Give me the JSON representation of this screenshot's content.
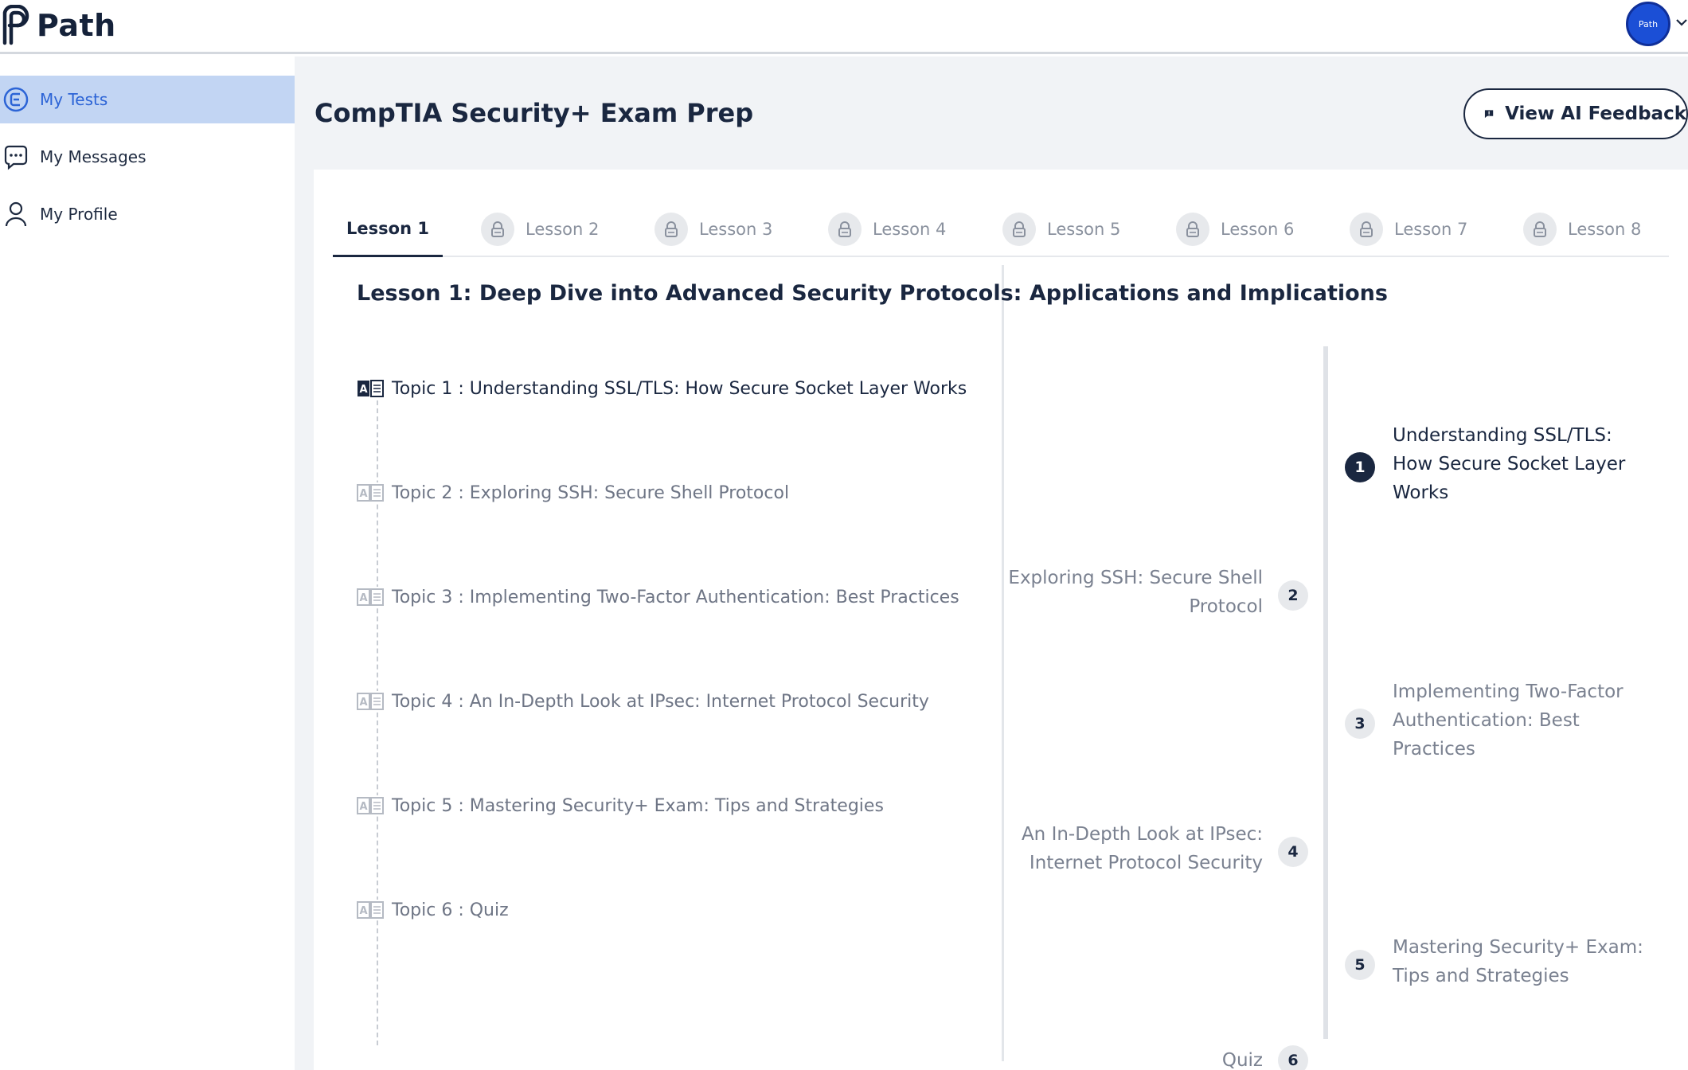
{
  "header": {
    "brand": "Path",
    "avatar_text": "Path"
  },
  "sidebar": {
    "items": [
      {
        "label": "My Tests",
        "icon": "tests-icon",
        "active": true
      },
      {
        "label": "My Messages",
        "icon": "chat-bubble-icon",
        "active": false
      },
      {
        "label": "My Profile",
        "icon": "user-icon",
        "active": false
      }
    ]
  },
  "page": {
    "title": "CompTIA Security+ Exam Prep",
    "feedback_button": "View AI Feedback"
  },
  "tabs": [
    {
      "label": "Lesson 1",
      "locked": false,
      "active": true
    },
    {
      "label": "Lesson 2",
      "locked": true,
      "active": false
    },
    {
      "label": "Lesson 3",
      "locked": true,
      "active": false
    },
    {
      "label": "Lesson 4",
      "locked": true,
      "active": false
    },
    {
      "label": "Lesson 5",
      "locked": true,
      "active": false
    },
    {
      "label": "Lesson 6",
      "locked": true,
      "active": false
    },
    {
      "label": "Lesson 7",
      "locked": true,
      "active": false
    },
    {
      "label": "Lesson 8",
      "locked": true,
      "active": false
    }
  ],
  "lesson": {
    "heading": "Lesson 1: Deep Dive into Advanced Security Protocols: Applications and Implications",
    "topics": [
      {
        "label": "Topic 1 : Understanding SSL/TLS: How Secure Socket Layer Works",
        "current": true
      },
      {
        "label": "Topic 2 : Exploring SSH: Secure Shell Protocol",
        "current": false
      },
      {
        "label": "Topic 3 : Implementing Two-Factor Authentication: Best Practices",
        "current": false
      },
      {
        "label": "Topic 4 : An In-Depth Look at IPsec: Internet Protocol Security",
        "current": false
      },
      {
        "label": "Topic 5 : Mastering Security+ Exam: Tips and Strategies",
        "current": false
      },
      {
        "label": "Topic 6 : Quiz",
        "current": false
      }
    ]
  },
  "timeline": [
    {
      "number": "1",
      "side": "right",
      "lines": [
        "Understanding SSL/TLS:",
        "How Secure Socket Layer",
        "Works"
      ],
      "current": true
    },
    {
      "number": "2",
      "side": "left",
      "lines": [
        "Exploring SSH: Secure Shell",
        "Protocol"
      ],
      "current": false
    },
    {
      "number": "3",
      "side": "right",
      "lines": [
        "Implementing Two-Factor",
        "Authentication: Best",
        "Practices"
      ],
      "current": false
    },
    {
      "number": "4",
      "side": "left",
      "lines": [
        "An In-Depth Look at IPsec:",
        "Internet Protocol Security"
      ],
      "current": false
    },
    {
      "number": "5",
      "side": "right",
      "lines": [
        "Mastering Security+ Exam:",
        "Tips and Strategies"
      ],
      "current": false
    },
    {
      "number": "6",
      "side": "left",
      "lines": [
        "Quiz"
      ],
      "current": false
    }
  ],
  "colors": {
    "accent_blue": "#2c64d6",
    "active_nav_bg": "#c2d5f3",
    "navy": "#1a2740",
    "muted_text": "#7a8190",
    "main_bg": "#f1f3f6"
  }
}
